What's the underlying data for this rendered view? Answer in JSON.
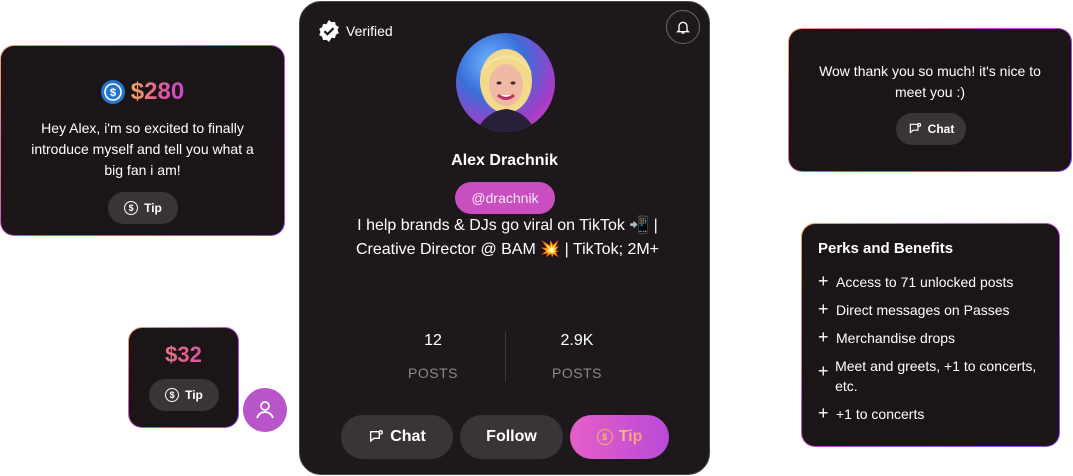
{
  "left_card": {
    "amount": "$280",
    "message": "Hey Alex, i'm so excited to finally introduce myself and tell you what a big fan i am!",
    "tip_label": "Tip"
  },
  "small_card": {
    "amount": "$32",
    "tip_label": "Tip"
  },
  "profile": {
    "verified_label": "Verified",
    "name": "Alex Drachnik",
    "handle": "@drachnik",
    "bio": "I help brands & DJs go viral on TikTok 📲 | Creative Director @ BAM 💥 | TikTok; 2M+",
    "stats": [
      {
        "value": "12",
        "label": "POSTS"
      },
      {
        "value": "2.9K",
        "label": "POSTS"
      }
    ],
    "buttons": {
      "chat": "Chat",
      "follow": "Follow",
      "tip": "Tip"
    }
  },
  "reply_card": {
    "message": "Wow thank you so much! it's nice to meet you :)",
    "chat_label": "Chat"
  },
  "perks": {
    "title": "Perks and Benefits",
    "items": [
      "Access to 71 unlocked posts",
      "Direct messages on Passes",
      "Merchandise drops",
      "Meet and greets, +1 to concerts, etc.",
      "+1 to concerts"
    ]
  },
  "colors": {
    "accent_gradient_start": "#f2a866",
    "accent_gradient_end": "#c04bd0",
    "handle_pill": "#c94fc0",
    "card_bg": "#1b1518"
  }
}
